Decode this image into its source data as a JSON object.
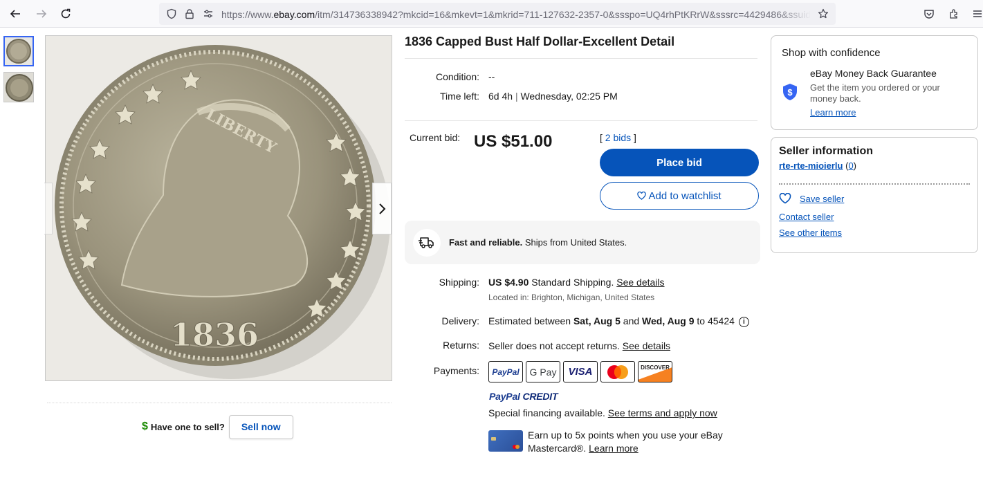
{
  "browser": {
    "url_prefix": "https://www.",
    "url_host": "ebay.com",
    "url_rest": "/itm/314736338942?mkcid=16&mkevt=1&mkrid=711-127632-2357-0&ssspo=UQ4rhPtKRrW&sssrc=4429486&ssuid"
  },
  "gallery": {
    "prev_label": "‹",
    "next_label": "›"
  },
  "listing": {
    "title": "1836 Capped Bust Half Dollar-Excellent Detail",
    "condition_label": "Condition:",
    "condition_value": "--",
    "time_left_label": "Time left:",
    "time_left_value": "6d 4h",
    "time_left_sep": "|",
    "time_left_end": "Wednesday, 02:25 PM",
    "current_bid_label": "Current bid:",
    "current_bid_value": "US $51.00",
    "bids_open": "[",
    "bids_link": "2 bids",
    "bids_close": "]",
    "place_bid": "Place bid",
    "add_watchlist": "Add to watchlist",
    "fast_bold": "Fast and reliable.",
    "fast_rest": "Ships from United States.",
    "shipping_label": "Shipping:",
    "shipping_price": "US $4.90",
    "shipping_service": "Standard Shipping.",
    "see_details": "See details",
    "located_in": "Located in: Brighton, Michigan, United States",
    "delivery_label": "Delivery:",
    "delivery_pre": "Estimated between",
    "delivery_start": "Sat, Aug 5",
    "delivery_and": "and",
    "delivery_end": "Wed, Aug 9",
    "delivery_to": "to 45424",
    "info_glyph": "i",
    "returns_label": "Returns:",
    "returns_value": "Seller does not accept returns.",
    "returns_link": "See details",
    "payments_label": "Payments:",
    "payment_methods": [
      "PayPal",
      "G Pay",
      "VISA",
      "Mastercard",
      "DISCOVER"
    ],
    "paypal_credit_a": "PayPal",
    "paypal_credit_b": "CREDIT",
    "special_text": "Special financing available.",
    "special_link": "See terms and apply now",
    "earn_line1": "Earn up to 5x points when you use your eBay",
    "earn_line2": "Mastercard®.",
    "earn_link": "Learn more",
    "have_one": "Have one to sell?",
    "sell_now": "Sell now",
    "dollar_glyph": "$"
  },
  "confidence": {
    "title": "Shop with confidence",
    "mbg_title": "eBay Money Back Guarantee",
    "mbg_desc": "Get the item you ordered or your money back.",
    "learn_more": "Learn more"
  },
  "seller": {
    "title": "Seller information",
    "name": "rte-rte-mioierlu",
    "feedback_open": "(",
    "feedback": "0",
    "feedback_close": ")",
    "save_seller": "Save seller",
    "contact_seller": "Contact seller",
    "see_other": "See other items"
  },
  "colors": {
    "ebay_blue": "#0654ba",
    "accent_blue": "#3665f3",
    "sell_dollar": "#198a00"
  },
  "coin": {
    "legend": "LIBERTY",
    "year": "1836"
  }
}
